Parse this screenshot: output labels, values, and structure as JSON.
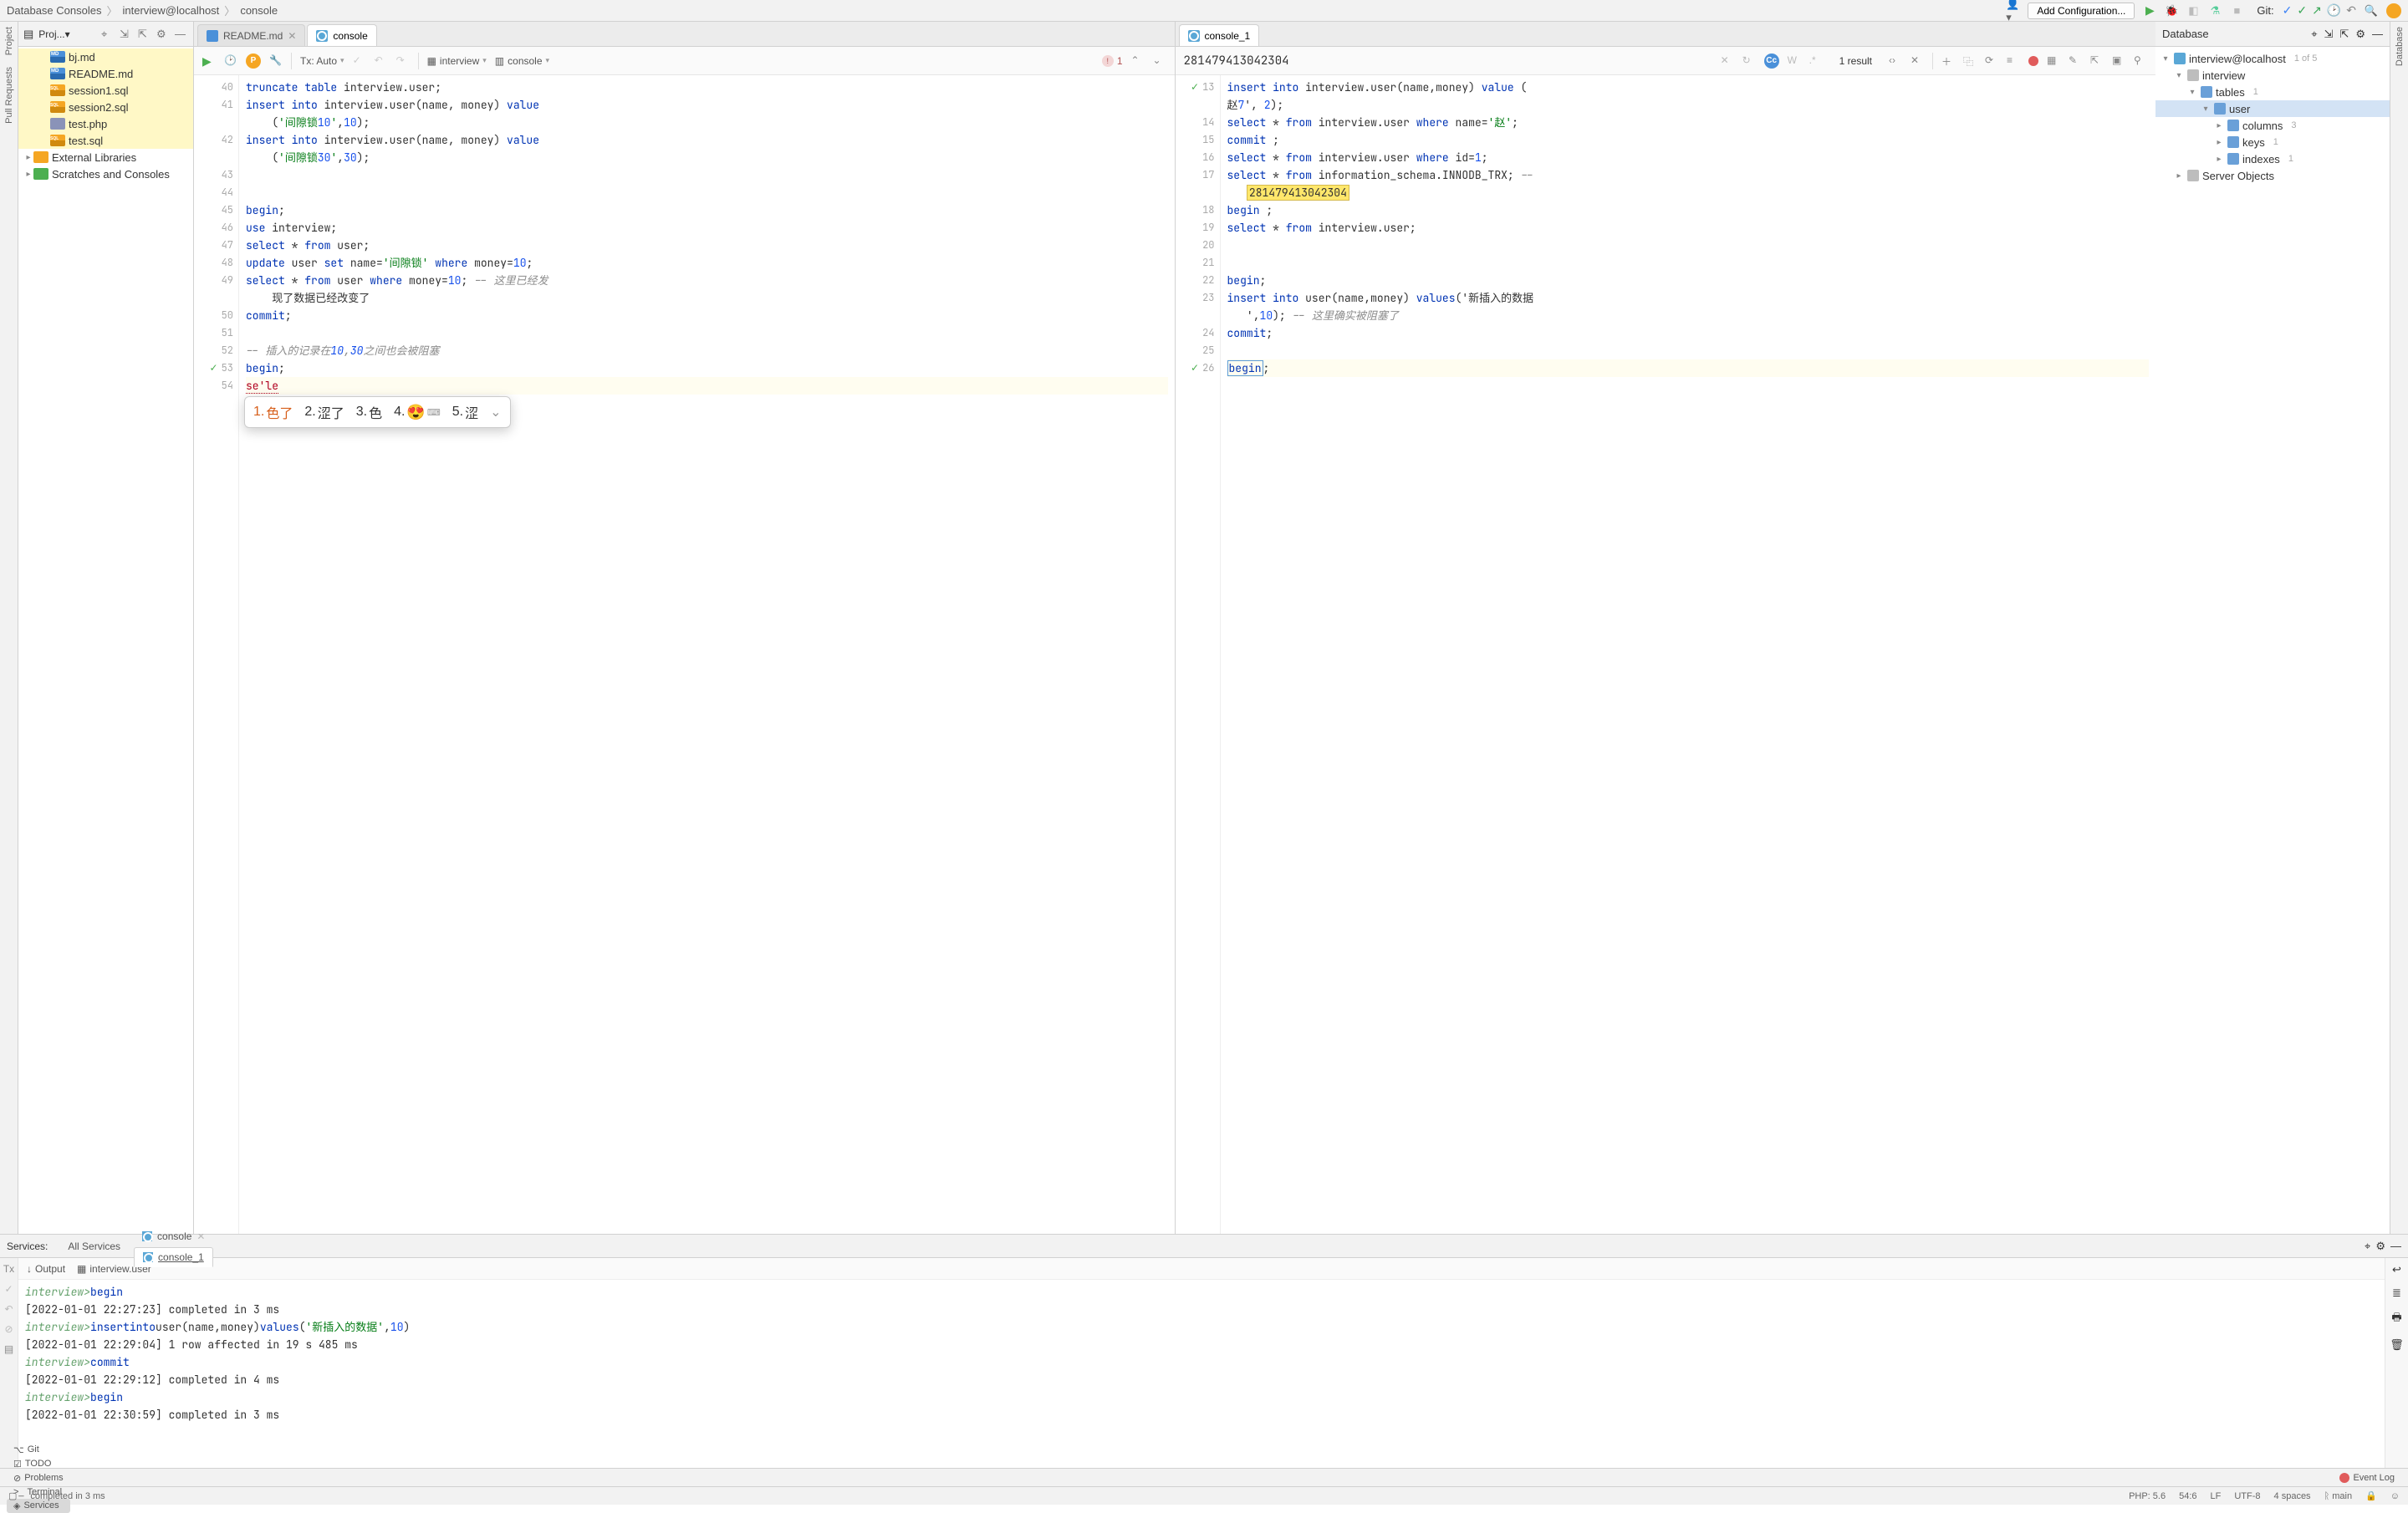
{
  "breadcrumb": {
    "items": [
      "Database Consoles",
      "interview@localhost",
      "console"
    ]
  },
  "toolbar": {
    "add_config": "Add Configuration...",
    "git_label": "Git:"
  },
  "left_stripe": [
    "Project",
    "Pull Requests"
  ],
  "right_stripe": [
    "Database"
  ],
  "project": {
    "title": "Proj...",
    "files": [
      {
        "name": "bj.md",
        "icon": "md",
        "sel": true
      },
      {
        "name": "README.md",
        "icon": "md",
        "sel": true
      },
      {
        "name": "session1.sql",
        "icon": "sql",
        "sel": true
      },
      {
        "name": "session2.sql",
        "icon": "sql",
        "sel": true
      },
      {
        "name": "test.php",
        "icon": "php",
        "sel": true
      },
      {
        "name": "test.sql",
        "icon": "sql",
        "sel": true
      }
    ],
    "ext_lib": "External Libraries",
    "scratch": "Scratches and Consoles"
  },
  "tabs_left": [
    {
      "label": "README.md",
      "icon": "md",
      "active": false,
      "close": true
    },
    {
      "label": "console",
      "icon": "con",
      "active": true,
      "close": false
    }
  ],
  "tabs_right": [
    {
      "label": "console_1",
      "icon": "con",
      "active": true,
      "close": false
    }
  ],
  "tx_label": "Tx: Auto",
  "ds_left": "interview",
  "schema_left": "console",
  "err_count": "1",
  "result_id": "281479413042304",
  "result_label": "1 result",
  "left_editor": {
    "start": 40,
    "lines": [
      {
        "n": 40,
        "t": "truncate table interview.user;"
      },
      {
        "n": 41,
        "t": "insert into interview.user(name, money) value"
      },
      {
        "n": "",
        "t": "    ('间隙锁10',10);"
      },
      {
        "n": 42,
        "t": "insert into interview.user(name, money) value"
      },
      {
        "n": "",
        "t": "    ('间隙锁30',30);"
      },
      {
        "n": 43,
        "t": ""
      },
      {
        "n": 44,
        "t": ""
      },
      {
        "n": 45,
        "t": "begin;"
      },
      {
        "n": 46,
        "t": "use interview;"
      },
      {
        "n": 47,
        "t": "select * from user;"
      },
      {
        "n": 48,
        "t": "update user set name='间隙锁' where money=10;"
      },
      {
        "n": 49,
        "t": "select * from user where money=10; -- 这里已经发"
      },
      {
        "n": "",
        "t": "    现了数据已经改变了"
      },
      {
        "n": 50,
        "t": "commit;"
      },
      {
        "n": 51,
        "t": ""
      },
      {
        "n": 52,
        "t": "-- 插入的记录在10,30之间也会被阻塞"
      },
      {
        "n": 53,
        "t": "begin;",
        "ok": true
      },
      {
        "n": 54,
        "t": "se'le",
        "curr": true
      }
    ]
  },
  "ime": {
    "cands": [
      {
        "n": "1",
        "t": "色了",
        "sel": true
      },
      {
        "n": "2",
        "t": "涩了"
      },
      {
        "n": "3",
        "t": "色"
      },
      {
        "n": "4",
        "t": "😍",
        "emo": true
      },
      {
        "n": "5",
        "t": "涩"
      }
    ]
  },
  "right_editor": {
    "lines": [
      {
        "n": 13,
        "t": "insert into interview.user(name,money) value (",
        "ok": true
      },
      {
        "n": "",
        "t": "赵7', 2);"
      },
      {
        "n": 14,
        "t": "select * from interview.user where name='赵';"
      },
      {
        "n": 15,
        "t": "commit ;"
      },
      {
        "n": 16,
        "t": "select * from interview.user where id=1;"
      },
      {
        "n": 17,
        "t": "select * from information_schema.INNODB_TRX; --"
      },
      {
        "n": "",
        "t": "   281479413042304",
        "hl": true
      },
      {
        "n": 18,
        "t": "begin ;"
      },
      {
        "n": 19,
        "t": "select * from interview.user;"
      },
      {
        "n": 20,
        "t": ""
      },
      {
        "n": 21,
        "t": ""
      },
      {
        "n": 22,
        "t": "begin;"
      },
      {
        "n": 23,
        "t": "insert into user(name,money) values('新插入的数据"
      },
      {
        "n": "",
        "t": "   ',10); -- 这里确实被阻塞了"
      },
      {
        "n": 24,
        "t": "commit;"
      },
      {
        "n": 25,
        "t": ""
      },
      {
        "n": 26,
        "t": "begin;",
        "ok": true,
        "curr": true,
        "box": true
      }
    ]
  },
  "db": {
    "title": "Database",
    "root": "interview@localhost",
    "root_hint": "1 of 5",
    "schema": "interview",
    "tables": "tables",
    "tables_hint": "1",
    "table": "user",
    "cols": "columns",
    "cols_hint": "3",
    "keys": "keys",
    "keys_hint": "1",
    "idx": "indexes",
    "idx_hint": "1",
    "srv": "Server Objects"
  },
  "services": {
    "label": "Services:",
    "all": "All Services",
    "tabs": [
      {
        "label": "console"
      },
      {
        "label": "console_1",
        "active": true
      }
    ],
    "sub": [
      {
        "label": "Output",
        "icon": "↓"
      },
      {
        "label": "interview.user",
        "icon": "▦"
      }
    ],
    "lines": [
      {
        "p": "interview>",
        "q": "begin"
      },
      {
        "t": "[2022-01-01 22:27:23] completed in 3 ms"
      },
      {
        "p": "interview>",
        "q": "insert into user(name,money) values('新插入的数据',10)"
      },
      {
        "t": "[2022-01-01 22:29:04] 1 row affected in 19 s 485 ms"
      },
      {
        "p": "interview>",
        "q": "commit"
      },
      {
        "t": "[2022-01-01 22:29:12] completed in 4 ms"
      },
      {
        "p": "interview>",
        "q": "begin"
      },
      {
        "t": "[2022-01-01 22:30:59] completed in 3 ms"
      }
    ]
  },
  "bottom": {
    "tabs": [
      {
        "icon": "⌥",
        "label": "Git"
      },
      {
        "icon": "☑",
        "label": "TODO"
      },
      {
        "icon": "⊘",
        "label": "Problems"
      },
      {
        "icon": ">_",
        "label": "Terminal"
      },
      {
        "icon": "◈",
        "label": "Services",
        "active": true
      }
    ],
    "event_log": "Event Log"
  },
  "status": {
    "msg": "completed in 3 ms",
    "php": "PHP: 5.6",
    "pos": "54:6",
    "lf": "LF",
    "enc": "UTF-8",
    "indent": "4 spaces",
    "branch": "main"
  }
}
